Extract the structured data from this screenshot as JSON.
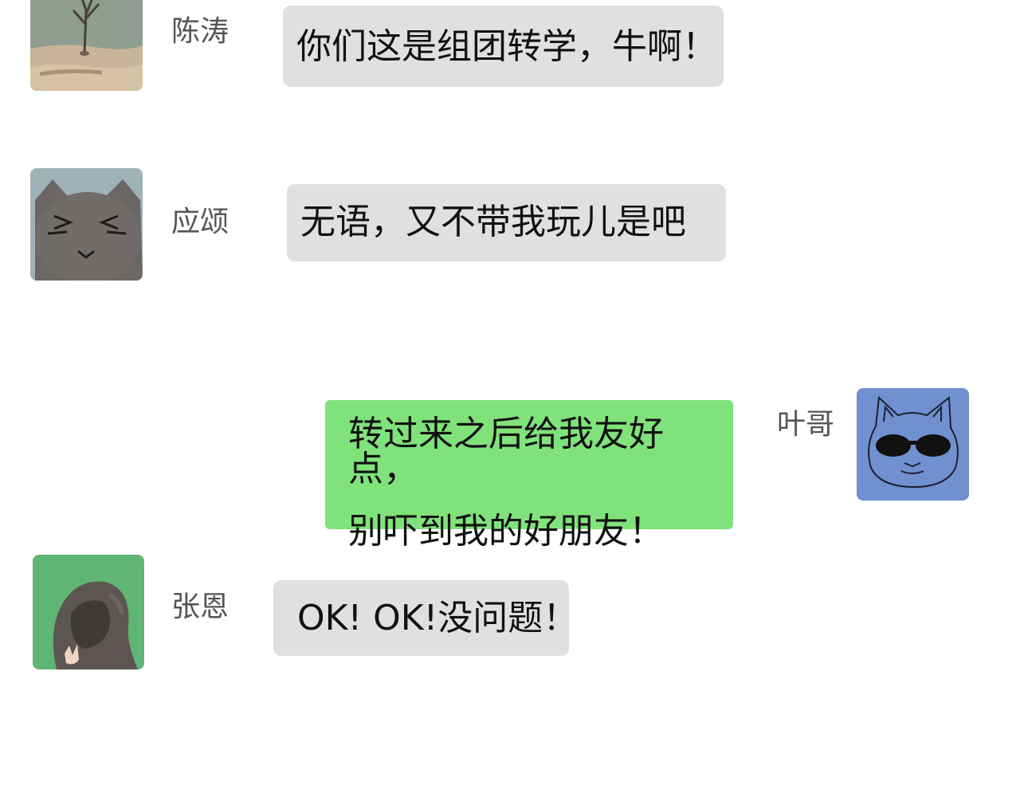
{
  "colors": {
    "other_bubble": "#e0e0e0",
    "self_bubble": "#80e27a",
    "name_text": "#555555",
    "message_text": "#111111"
  },
  "messages": [
    {
      "sender": "陈涛",
      "avatar_icon": "tree-landscape-avatar-icon",
      "side": "left",
      "text": "你们这是组团转学，牛啊！"
    },
    {
      "sender": "应颂",
      "avatar_icon": "grumpy-gray-cat-avatar-icon",
      "side": "left",
      "text": "无语，又不带我玩儿是吧"
    },
    {
      "sender": "叶哥",
      "avatar_icon": "sunglasses-cat-avatar-icon",
      "side": "right",
      "lines": [
        "转过来之后给我友好点，",
        "别吓到我的好朋友！"
      ]
    },
    {
      "sender": "张恩",
      "avatar_icon": "hooded-person-avatar-icon",
      "side": "left",
      "text": "OK! OK!没问题！"
    }
  ]
}
